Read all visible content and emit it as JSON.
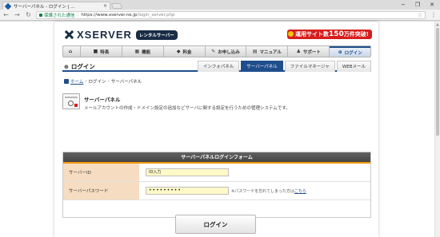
{
  "browser": {
    "tab_title": "サーバーパネル - ログイン | ...",
    "tab_close": "×",
    "window_minimize": "−",
    "window_maximize": "❐",
    "window_close": "✕",
    "back_icon": "←",
    "forward_icon": "→",
    "reload_icon": "↻",
    "secure_label": "保護された通信",
    "url_host": "https://www.xserver.ne.jp",
    "url_path": "/login_server.php",
    "bookmark_icon": "☆",
    "menu_icon": "⋮"
  },
  "header": {
    "brand": "XSERVER",
    "badge": "レンタルサーバー",
    "promo_prefix": "運用サイト数",
    "promo_number": "150",
    "promo_suffix": "万件突破!"
  },
  "global_nav": [
    {
      "icon": "⌂",
      "label": ""
    },
    {
      "icon": "■",
      "label": "特長"
    },
    {
      "icon": "▦",
      "label": "機能"
    },
    {
      "icon": "◆",
      "label": "料金"
    },
    {
      "icon": "✎",
      "label": "お申し込み"
    },
    {
      "icon": "▤",
      "label": "マニュアル"
    },
    {
      "icon": "♟",
      "label": "サポート"
    },
    {
      "icon": "⊕",
      "label": "ログイン"
    }
  ],
  "section": {
    "icon": "⊕",
    "title": "ログイン",
    "tabs": [
      "インフォパネル",
      "サーバーパネル",
      "ファイルマネージャ",
      "WEBメール"
    ],
    "active_tab": "サーバーパネル"
  },
  "breadcrumb": {
    "home": "ホーム",
    "sep": "›",
    "login": "ログイン",
    "current": "サーバーパネル"
  },
  "description": {
    "title": "サーバーパネル",
    "text": "メールアカウントの作成・ドメイン設定の追加などサーバに関する設定を行うための管理システムです。"
  },
  "form": {
    "title": "サーバーパネルログインフォーム",
    "id_label": "サーバーID",
    "id_value": "ID入力",
    "password_label": "サーバーパスワード",
    "password_value": "•••••••••",
    "forgot_prefix": "※パスワードを忘れてしまった方は",
    "forgot_link": "こちら",
    "submit": "ログイン"
  },
  "colors": {
    "brand_navy": "#1a2c44",
    "accent_blue": "#1f4e8c",
    "promo_red": "#d71c1c",
    "form_orange": "#f39800",
    "label_bg": "#f6dcc0",
    "input_bg": "#fff9c8"
  }
}
